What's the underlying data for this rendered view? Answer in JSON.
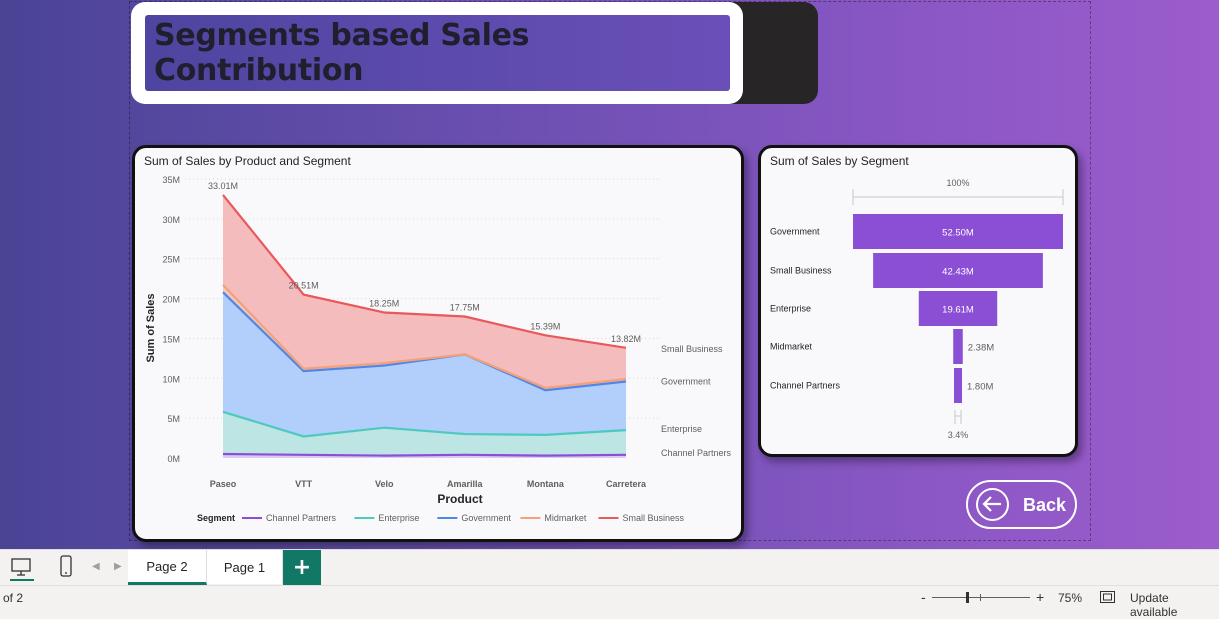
{
  "title": "Segments based Sales Contribution",
  "area_chart": {
    "title": "Sum of Sales by Product and Segment",
    "chart_data": {
      "type": "area",
      "categories": [
        "Paseo",
        "VTT",
        "Velo",
        "Amarilla",
        "Montana",
        "Carretera"
      ],
      "xlabel": "Product",
      "ylabel": "Sum of Sales",
      "ylim": [
        0,
        35
      ],
      "yticks": [
        "0M",
        "5M",
        "10M",
        "15M",
        "20M",
        "25M",
        "30M",
        "35M"
      ],
      "stacked": true,
      "series": [
        {
          "name": "Channel Partners",
          "color": "#8a4fd4",
          "values": [
            0.5,
            0.4,
            0.3,
            0.4,
            0.3,
            0.4
          ]
        },
        {
          "name": "Enterprise",
          "color": "#4ec9c0",
          "values": [
            5.3,
            2.3,
            3.5,
            2.6,
            2.6,
            3.1
          ]
        },
        {
          "name": "Government",
          "color": "#4f87e8",
          "values": [
            15.0,
            8.2,
            7.8,
            10.0,
            5.6,
            6.1
          ]
        },
        {
          "name": "Midmarket",
          "color": "#f4a07a",
          "values": [
            0.9,
            0.3,
            0.3,
            0.0,
            0.3,
            0.3
          ]
        },
        {
          "name": "Small Business",
          "color": "#e8595c",
          "values": [
            11.3,
            9.3,
            6.35,
            4.75,
            6.59,
            3.92
          ]
        }
      ],
      "totals": [
        33.01,
        20.51,
        18.25,
        17.75,
        15.39,
        13.82
      ],
      "total_labels": [
        "33.01M",
        "20.51M",
        "18.25M",
        "17.75M",
        "15.39M",
        "13.82M"
      ],
      "end_labels": [
        "Small Business",
        "Government",
        "Enterprise",
        "Channel Partners"
      ],
      "legend_title": "Segment",
      "legend_position": "bottom",
      "grid": true
    }
  },
  "funnel_chart": {
    "title": "Sum of Sales by Segment",
    "top_label": "100%",
    "bottom_label": "3.4%",
    "chart_data": {
      "type": "bar",
      "categories": [
        "Government",
        "Small Business",
        "Enterprise",
        "Midmarket",
        "Channel Partners"
      ],
      "values": [
        52.5,
        42.43,
        19.61,
        2.38,
        1.8
      ],
      "value_labels": [
        "52.50M",
        "42.43M",
        "19.61M",
        "2.38M",
        "1.80M"
      ],
      "color": "#8a4fd4"
    }
  },
  "back_button": {
    "label": "Back"
  },
  "tabs": [
    {
      "label": "Page 2",
      "active": true
    },
    {
      "label": "Page 1",
      "active": false
    }
  ],
  "add_tab": "+",
  "status": {
    "page_info": "of 2",
    "zoom_minus": "-",
    "zoom_plus": "+",
    "zoom": "75%",
    "update": "Update available"
  },
  "icons": {
    "desktop": "desktop-icon",
    "phone": "phone-icon",
    "fit": "fit-page-icon"
  }
}
